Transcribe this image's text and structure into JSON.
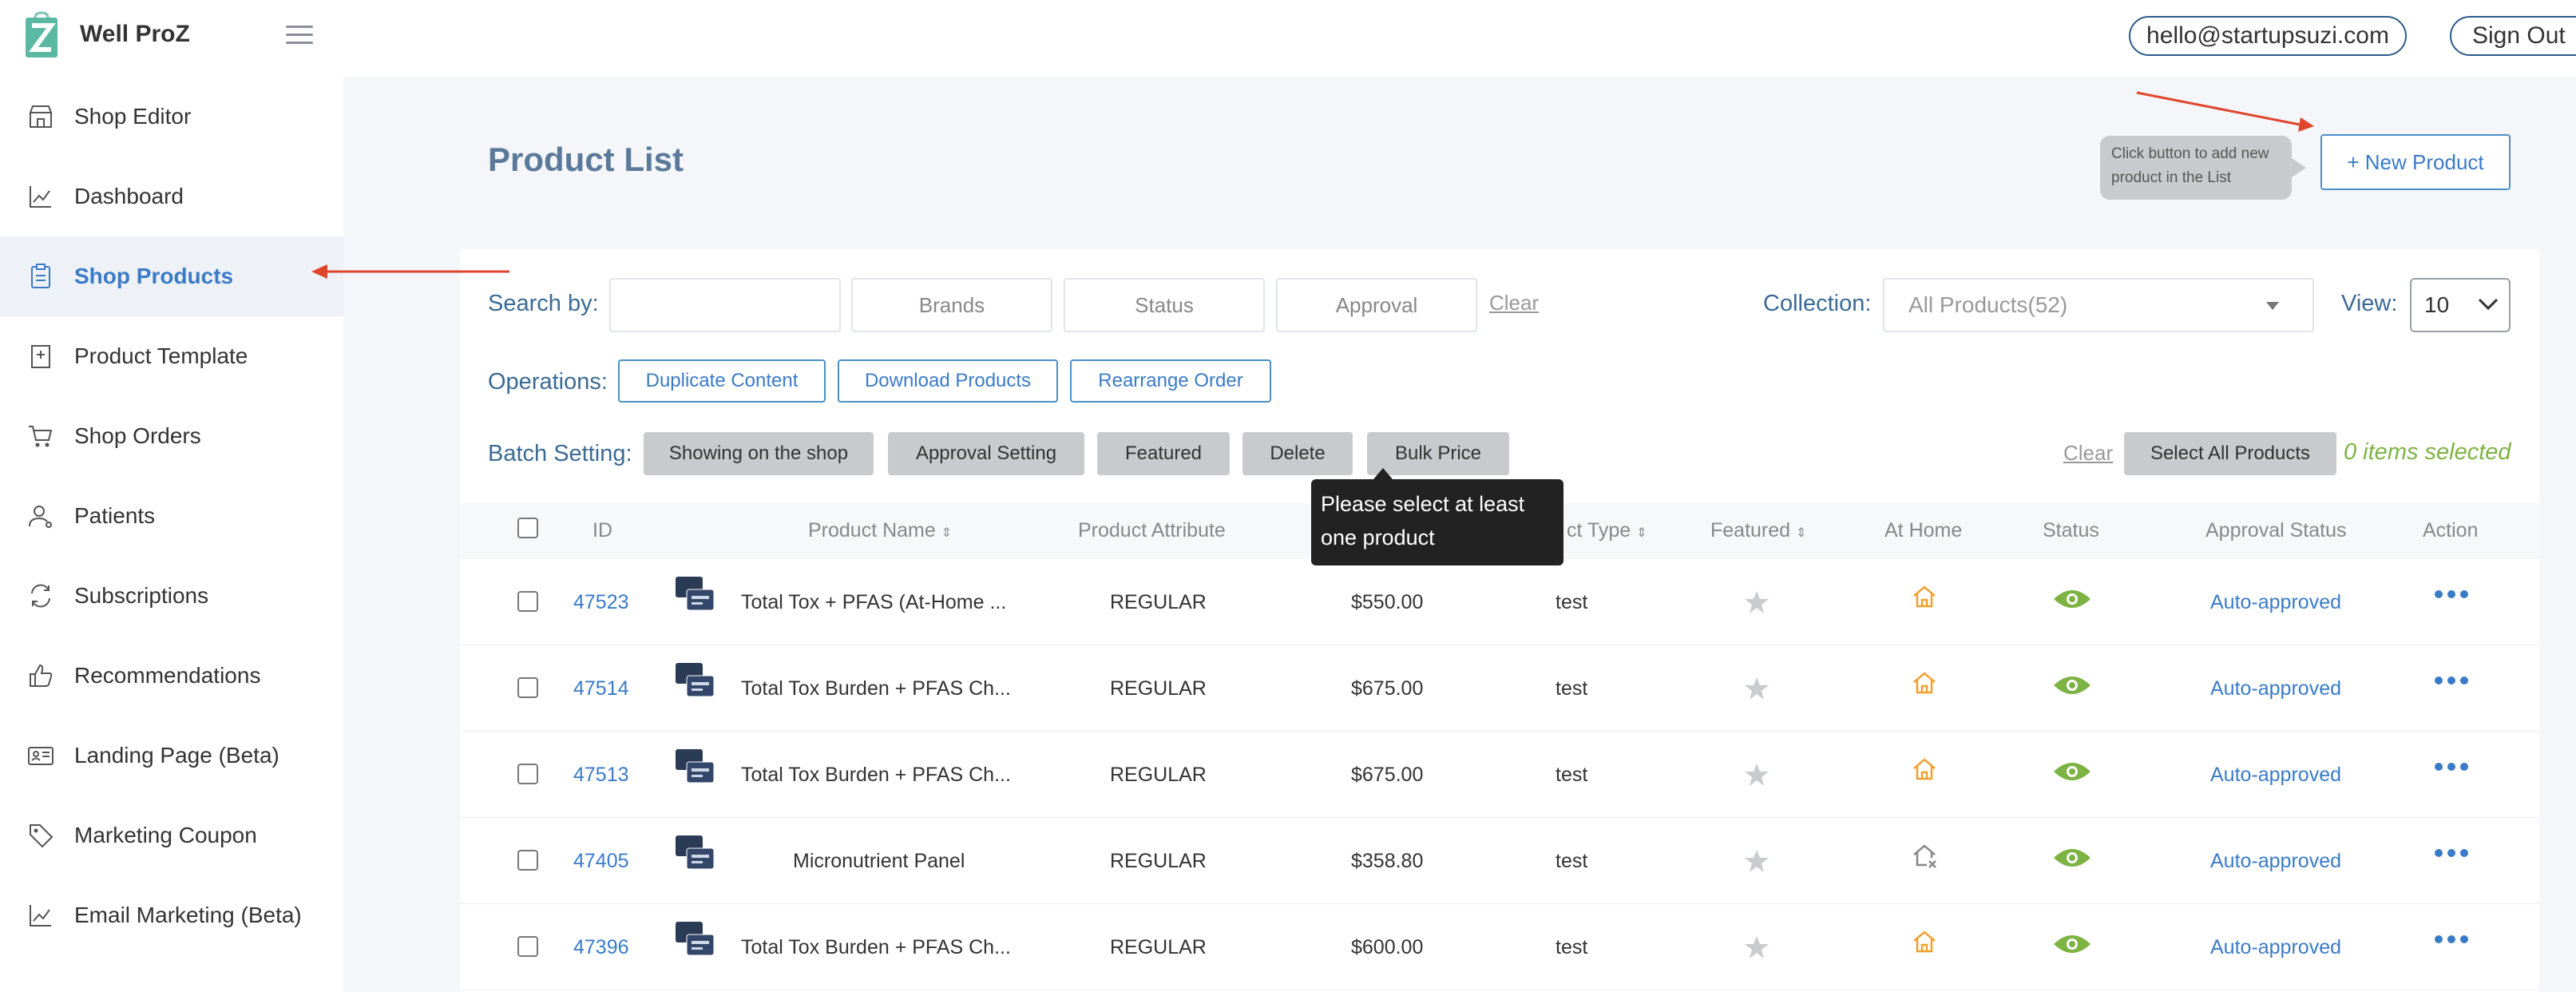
{
  "app": {
    "brand": "Well ProZ",
    "email": "hello@startupsuzi.com",
    "sign_out": "Sign Out"
  },
  "sidebar": {
    "items": [
      {
        "label": "Shop Editor",
        "icon": "storefront-icon"
      },
      {
        "label": "Dashboard",
        "icon": "chart-line-icon"
      },
      {
        "label": "Shop Products",
        "icon": "clipboard-icon",
        "active": true
      },
      {
        "label": "Product Template",
        "icon": "template-icon"
      },
      {
        "label": "Shop Orders",
        "icon": "cart-icon"
      },
      {
        "label": "Patients",
        "icon": "user-icon"
      },
      {
        "label": "Subscriptions",
        "icon": "refresh-icon"
      },
      {
        "label": "Recommendations",
        "icon": "thumbs-up-icon"
      },
      {
        "label": "Landing Page (Beta)",
        "icon": "id-card-icon"
      },
      {
        "label": "Marketing Coupon",
        "icon": "tag-icon"
      },
      {
        "label": "Email Marketing (Beta)",
        "icon": "chart-line-icon"
      }
    ]
  },
  "page": {
    "title": "Product List",
    "tip": "Click button to add new product in the List",
    "new_product": "+ New Product"
  },
  "filters": {
    "search_label": "Search by:",
    "search_value": "",
    "brands": "Brands",
    "status": "Status",
    "approval": "Approval",
    "clear": "Clear",
    "collection_label": "Collection:",
    "collection_value": "All Products(52)",
    "view_label": "View:",
    "view_value": "10"
  },
  "operations": {
    "label": "Operations:",
    "buttons": [
      "Duplicate Content",
      "Download Products",
      "Rearrange Order"
    ]
  },
  "batch": {
    "label": "Batch Setting:",
    "buttons": [
      "Showing on the shop",
      "Approval Setting",
      "Featured",
      "Delete",
      "Bulk Price"
    ],
    "clear": "Clear",
    "select_all": "Select All Products",
    "selected": "0 items selected",
    "tooltip": "Please select at least one product"
  },
  "table": {
    "headers": [
      "ID",
      "Product Name",
      "Product Attribute",
      "ct Type",
      "Featured",
      "At Home",
      "Status",
      "Approval Status",
      "Action"
    ],
    "rows": [
      {
        "id": "47523",
        "name": "Total Tox + PFAS (At-Home ...",
        "attribute": "REGULAR",
        "price": "$550.00",
        "type": "test",
        "at_home": true,
        "approval": "Auto-approved"
      },
      {
        "id": "47514",
        "name": "Total Tox Burden + PFAS Ch...",
        "attribute": "REGULAR",
        "price": "$675.00",
        "type": "test",
        "at_home": true,
        "approval": "Auto-approved"
      },
      {
        "id": "47513",
        "name": "Total Tox Burden + PFAS Ch...",
        "attribute": "REGULAR",
        "price": "$675.00",
        "type": "test",
        "at_home": true,
        "approval": "Auto-approved"
      },
      {
        "id": "47405",
        "name": "Micronutrient Panel",
        "attribute": "REGULAR",
        "price": "$358.80",
        "type": "test",
        "at_home": false,
        "approval": "Auto-approved"
      },
      {
        "id": "47396",
        "name": "Total Tox Burden + PFAS Ch...",
        "attribute": "REGULAR",
        "price": "$600.00",
        "type": "test",
        "at_home": true,
        "approval": "Auto-approved"
      }
    ]
  },
  "colors": {
    "accent": "#3a7bc8",
    "annotation_red": "#e0452b",
    "status_green": "#7cb342",
    "home_orange": "#f0a030"
  }
}
